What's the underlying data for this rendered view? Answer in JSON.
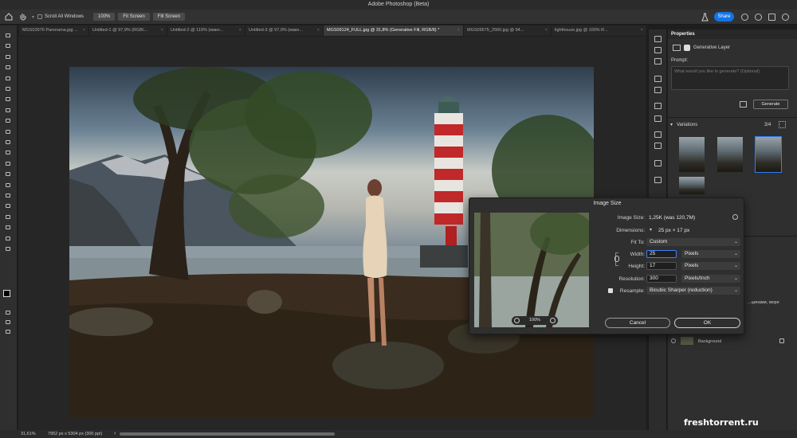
{
  "app": {
    "title": "Adobe Photoshop (Beta)"
  },
  "options_bar": {
    "scroll_all_windows": "Scroll All Windows",
    "zoom": "100%",
    "fit_screen": "Fit Screen",
    "fill_screen": "Fill Screen",
    "share": "Share"
  },
  "tabs": [
    {
      "label": "MGS03976 Panorama.jpg ...",
      "active": false
    },
    {
      "label": "Untitled-1 @ 97,9% (RGB/...",
      "active": false
    },
    {
      "label": "Untitled-2 @ 119% (макн...",
      "active": false
    },
    {
      "label": "Untitled-3 @ 97,9% (макн...",
      "active": false
    },
    {
      "label": "MGS09124_FULL.jpg @ 31,8% (Generative Fill, RGB/8) *",
      "active": true
    },
    {
      "label": "MGS09575_2560.jpg @ 94...",
      "active": false
    },
    {
      "label": "lighthouse.jpg @ 100% R...",
      "active": false
    }
  ],
  "properties": {
    "tab": "Properties",
    "layer_type": "Generative Layer",
    "prompt_label": "Prompt:",
    "prompt_placeholder": "What would you like to generate? (Optional)",
    "generate": "Generate",
    "variations_label": "Variations",
    "variations_count": "3/4"
  },
  "layers": {
    "partial_text": "...цинами, море",
    "background": "Background"
  },
  "dialog": {
    "title": "Image Size",
    "image_size_label": "Image Size:",
    "image_size_value": "1,25K (was 120,7M)",
    "dimensions_label": "Dimensions:",
    "dimensions_value": "25 px  ×  17 px",
    "fit_to_label": "Fit To:",
    "fit_to_value": "Custom",
    "width_label": "Width:",
    "width_value": "25",
    "width_unit": "Pixels",
    "height_label": "Height:",
    "height_value": "17",
    "height_unit": "Pixels",
    "resolution_label": "Resolution:",
    "resolution_value": "300",
    "resolution_unit": "Pixels/Inch",
    "resample_label": "Resample:",
    "resample_value": "Bicubic Sharper (reduction)",
    "preview_zoom": "100%",
    "cancel": "Cancel",
    "ok": "OK"
  },
  "status": {
    "zoom": "31,61%",
    "doc_info": "7952 px x 5304 px (300 ppi)"
  },
  "watermark": "freshtorrent.ru",
  "colors": {
    "accent": "#1473e6",
    "selection": "#2f7cf6"
  }
}
